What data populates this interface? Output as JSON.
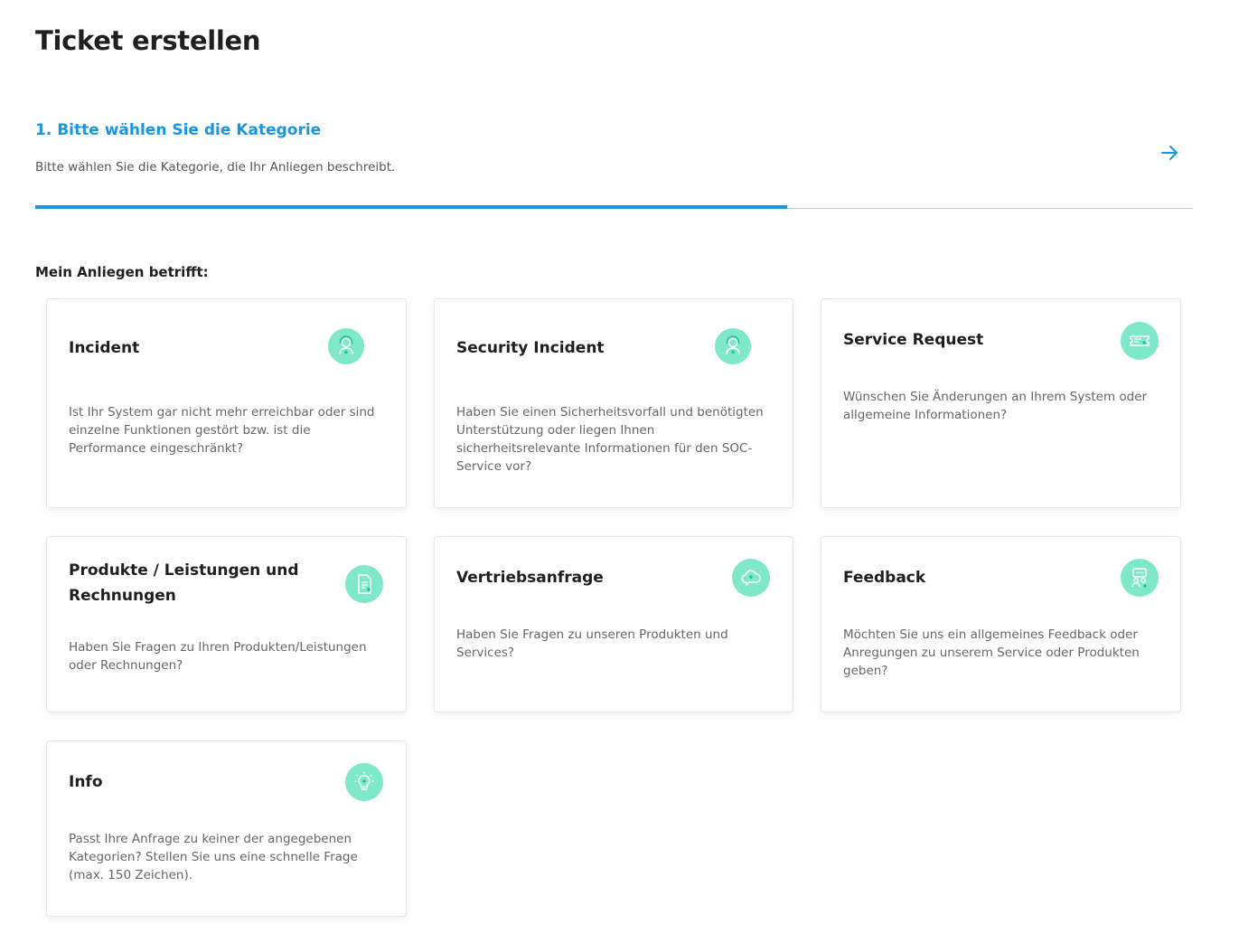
{
  "page": {
    "title": "Ticket erstellen"
  },
  "step": {
    "title": "1. Bitte wählen Sie die Kategorie",
    "description": "Bitte wählen Sie die Kategorie, die Ihr Anliegen beschreibt.",
    "progress_percent": 65,
    "next_icon": "arrow-right-icon"
  },
  "section": {
    "label": "Mein Anliegen betrifft:"
  },
  "colors": {
    "accent": "#1a95e0",
    "icon_bg": "#7fe8c9",
    "icon_stroke": "#ffffff",
    "icon_dot": "#14c98f"
  },
  "categories": [
    {
      "title": "Incident",
      "description": "Ist Ihr System gar nicht mehr erreichbar oder sind einzelne Funktionen gestört bzw. ist die Performance eingeschränkt?",
      "icon": "support-agent-icon"
    },
    {
      "title": "Security Incident",
      "description": "Haben Sie einen Sicherheitsvorfall und benötigten Unterstützung oder liegen Ihnen sicherheitsrelevante Informationen für den SOC-Service vor?",
      "icon": "security-agent-icon"
    },
    {
      "title": "Service Request",
      "description": "Wünschen Sie Änderungen an Ihrem System oder allgemeine Informationen?",
      "icon": "ticket-icon"
    },
    {
      "title": "Produkte / Leistungen und Rechnungen",
      "description": "Haben Sie Fragen zu Ihren Produkten/Leistungen oder Rechnungen?",
      "icon": "document-icon"
    },
    {
      "title": "Vertriebsanfrage",
      "description": "Haben Sie Fragen zu unseren Produkten und Services?",
      "icon": "cloud-chat-icon"
    },
    {
      "title": "Feedback",
      "description": "Möchten Sie uns ein allgemeines Feedback oder Anregungen zu unserem Service oder Produkten geben?",
      "icon": "feedback-people-icon"
    },
    {
      "title": "Info",
      "description": "Passt Ihre Anfrage zu keiner der angegebenen Kategorien? Stellen Sie uns eine schnelle Frage (max. 150 Zeichen).",
      "icon": "lightbulb-icon"
    }
  ]
}
